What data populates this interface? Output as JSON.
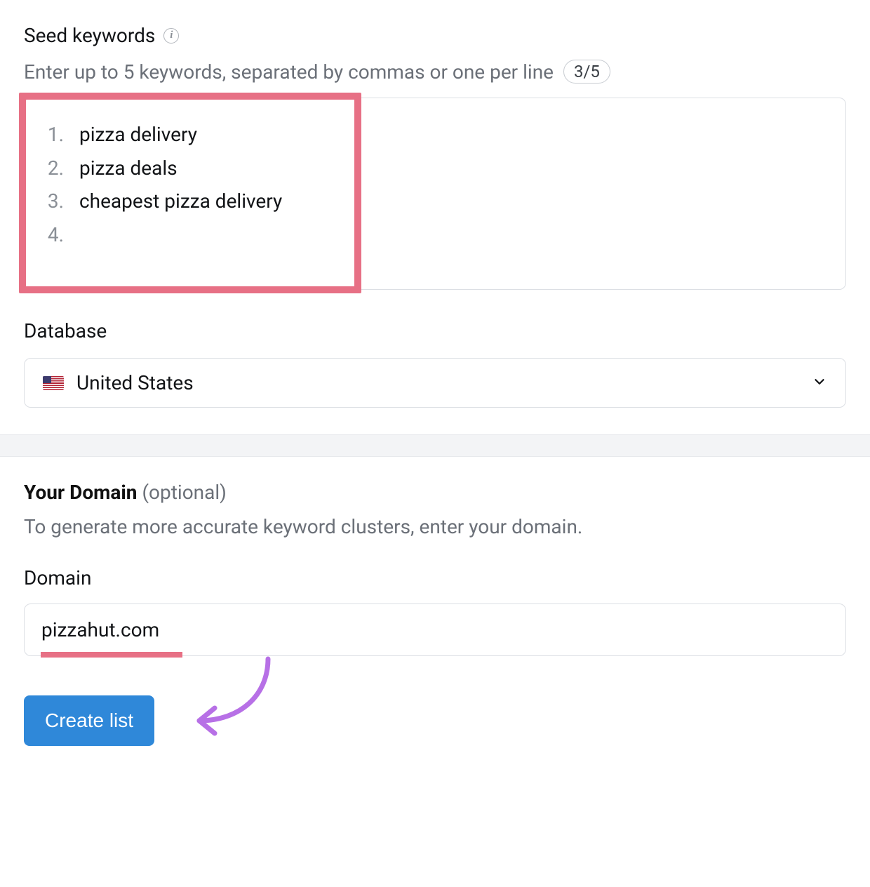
{
  "seed": {
    "label": "Seed keywords",
    "helper": "Enter up to 5 keywords, separated by commas or one per line",
    "counter": "3/5",
    "keywords": [
      "pizza delivery",
      "pizza deals",
      "cheapest pizza delivery"
    ],
    "next_index": "4."
  },
  "database": {
    "label": "Database",
    "selected": "United States"
  },
  "domain": {
    "heading": "Your Domain",
    "optional": "(optional)",
    "description": "To generate more accurate keyword clusters, enter your domain.",
    "input_label": "Domain",
    "value": "pizzahut.com"
  },
  "actions": {
    "create": "Create list"
  },
  "colors": {
    "highlight": "#e77085",
    "primary": "#2f88d9",
    "arrow": "#b770e6"
  }
}
